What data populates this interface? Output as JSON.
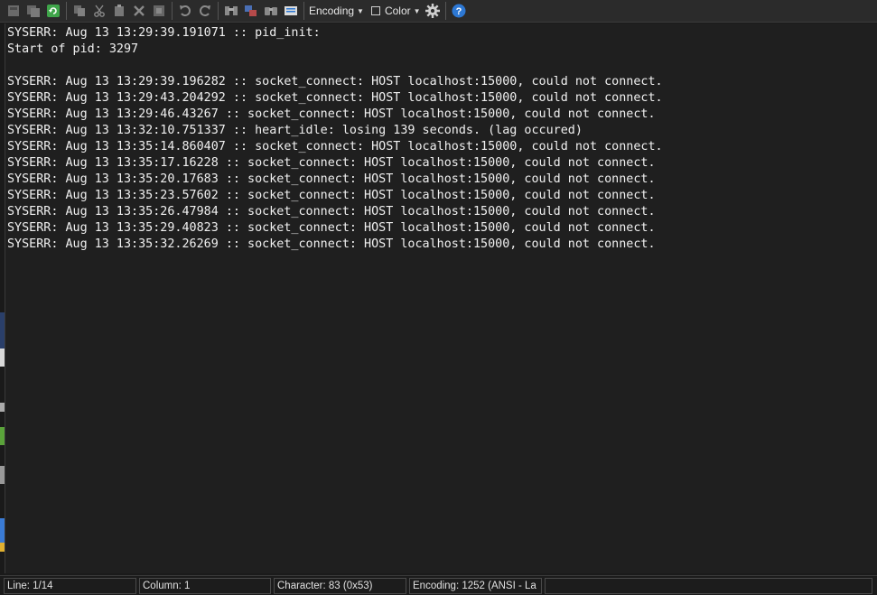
{
  "toolbar": {
    "encoding_label": "Encoding",
    "color_label": "Color",
    "colors": {
      "help_blue": "#2d78d4",
      "green_reload": "#3fa54a"
    }
  },
  "editor": {
    "lines": [
      "SYSERR: Aug 13 13:29:39.191071 :: pid_init:",
      "Start of pid: 3297",
      "",
      "SYSERR: Aug 13 13:29:39.196282 :: socket_connect: HOST localhost:15000, could not connect.",
      "SYSERR: Aug 13 13:29:43.204292 :: socket_connect: HOST localhost:15000, could not connect.",
      "SYSERR: Aug 13 13:29:46.43267 :: socket_connect: HOST localhost:15000, could not connect.",
      "SYSERR: Aug 13 13:32:10.751337 :: heart_idle: losing 139 seconds. (lag occured)",
      "SYSERR: Aug 13 13:35:14.860407 :: socket_connect: HOST localhost:15000, could not connect.",
      "SYSERR: Aug 13 13:35:17.16228 :: socket_connect: HOST localhost:15000, could not connect.",
      "SYSERR: Aug 13 13:35:20.17683 :: socket_connect: HOST localhost:15000, could not connect.",
      "SYSERR: Aug 13 13:35:23.57602 :: socket_connect: HOST localhost:15000, could not connect.",
      "SYSERR: Aug 13 13:35:26.47984 :: socket_connect: HOST localhost:15000, could not connect.",
      "SYSERR: Aug 13 13:35:29.40823 :: socket_connect: HOST localhost:15000, could not connect.",
      "SYSERR: Aug 13 13:35:32.26269 :: socket_connect: HOST localhost:15000, could not connect."
    ]
  },
  "status": {
    "line": "Line: 1/14",
    "column": "Column: 1",
    "character": "Character: 83 (0x53)",
    "encoding": "Encoding: 1252  (ANSI - La"
  }
}
